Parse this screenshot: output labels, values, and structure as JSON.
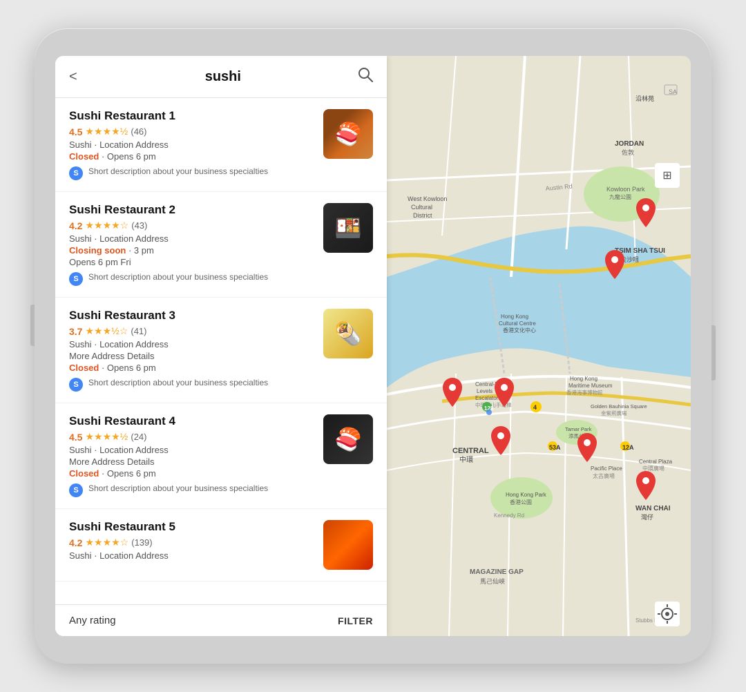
{
  "header": {
    "back_label": "<",
    "title": "sushi",
    "search_icon": "🔍"
  },
  "restaurants": [
    {
      "id": 1,
      "name": "Sushi Restaurant 1",
      "rating": "4.5",
      "stars_full": 4,
      "stars_half": true,
      "review_count": "(46)",
      "address_line1": "Sushi · Location Address",
      "address_line2": null,
      "status": "Closed",
      "status_type": "closed",
      "status_note": "· Opens 6 pm",
      "desc": "Short description about your business specialties",
      "image_class": "food-img-1"
    },
    {
      "id": 2,
      "name": "Sushi Restaurant 2",
      "rating": "4.2",
      "stars_full": 4,
      "stars_half": false,
      "review_count": "(43)",
      "address_line1": "Sushi · Location Address",
      "address_line2": null,
      "status": "Closing soon",
      "status_type": "closing",
      "status_note": "· 3 pm",
      "status_note2": "Opens 6 pm Fri",
      "desc": "Short description about your business specialties",
      "image_class": "food-img-2"
    },
    {
      "id": 3,
      "name": "Sushi Restaurant 3",
      "rating": "3.7",
      "stars_full": 3,
      "stars_half": true,
      "review_count": "(41)",
      "address_line1": "Sushi · Location Address",
      "address_line2": "More Address Details",
      "status": "Closed",
      "status_type": "closed",
      "status_note": "· Opens 6 pm",
      "desc": "Short description about your business specialties",
      "image_class": "food-img-3"
    },
    {
      "id": 4,
      "name": "Sushi Restaurant 4",
      "rating": "4.5",
      "stars_full": 4,
      "stars_half": true,
      "review_count": "(24)",
      "address_line1": "Sushi · Location Address",
      "address_line2": "More Address Details",
      "status": "Closed",
      "status_type": "closed",
      "status_note": "· Opens 6 pm",
      "desc": "Short description about your business specialties",
      "image_class": "food-img-4"
    },
    {
      "id": 5,
      "name": "Sushi Restaurant 5",
      "rating": "4.2",
      "stars_full": 4,
      "stars_half": false,
      "review_count": "(139)",
      "address_line1": "Sushi · Location Address",
      "address_line2": null,
      "status": null,
      "status_type": null,
      "status_note": null,
      "desc": null,
      "image_class": "food-img-5"
    }
  ],
  "footer": {
    "rating_label": "Any rating",
    "filter_label": "FILTER"
  },
  "map": {
    "layer_icon": "⊞",
    "location_icon": "◎"
  }
}
